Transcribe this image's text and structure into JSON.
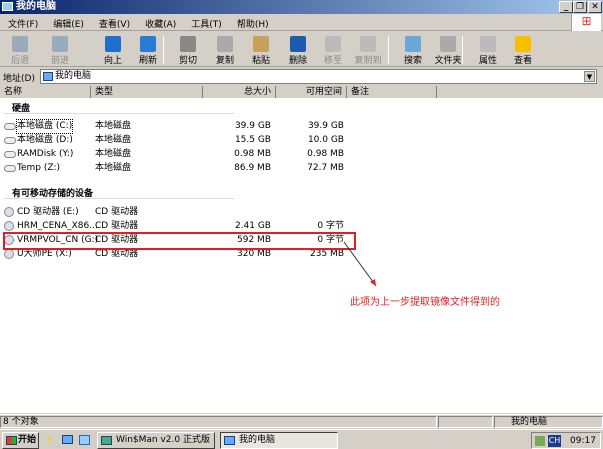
{
  "window": {
    "title": "我的电脑"
  },
  "menu": [
    "文件(F)",
    "编辑(E)",
    "查看(V)",
    "收藏(A)",
    "工具(T)",
    "帮助(H)"
  ],
  "toolbar": [
    {
      "label": "后退",
      "enabled": false,
      "color": "#9ab"
    },
    {
      "label": "前进",
      "enabled": false,
      "color": "#9ab"
    },
    {
      "label": "向上",
      "enabled": true,
      "color": "#1e6fd0"
    },
    {
      "label": "刷新",
      "enabled": true,
      "color": "#2a7bd6"
    },
    {
      "label": "剪切",
      "enabled": true,
      "color": "#888"
    },
    {
      "label": "复制",
      "enabled": true,
      "color": "#aaa"
    },
    {
      "label": "粘贴",
      "enabled": true,
      "color": "#c9a05a"
    },
    {
      "label": "删除",
      "enabled": true,
      "color": "#1c5bb0"
    },
    {
      "label": "移至",
      "enabled": false,
      "color": "#bbb"
    },
    {
      "label": "复制到",
      "enabled": false,
      "color": "#bbb"
    },
    {
      "label": "搜索",
      "enabled": true,
      "color": "#6aa7d8"
    },
    {
      "label": "文件夹",
      "enabled": true,
      "color": "#aaa"
    },
    {
      "label": "属性",
      "enabled": true,
      "color": "#bbb"
    },
    {
      "label": "查看",
      "enabled": true,
      "color": "#f5c000"
    }
  ],
  "address": {
    "label": "地址(D)",
    "value": "我的电脑"
  },
  "columns": [
    "名称",
    "类型",
    "总大小",
    "可用空间",
    "备注"
  ],
  "groups": [
    {
      "title": "硬盘",
      "items": [
        {
          "name": "本地磁盘 (C:)",
          "type": "本地磁盘",
          "size": "39.9 GB",
          "free": "39.9 GB"
        },
        {
          "name": "本地磁盘 (D:)",
          "type": "本地磁盘",
          "size": "15.5 GB",
          "free": "10.0 GB"
        },
        {
          "name": "RAMDisk (Y:)",
          "type": "本地磁盘",
          "size": "0.98 MB",
          "free": "0.98 MB"
        },
        {
          "name": "Temp (Z:)",
          "type": "本地磁盘",
          "size": "86.9 MB",
          "free": "72.7 MB"
        }
      ]
    },
    {
      "title": "有可移动存储的设备",
      "items": [
        {
          "name": "CD 驱动器 (E:)",
          "type": "CD 驱动器",
          "size": "",
          "free": ""
        },
        {
          "name": "HRM_CENA_X86...",
          "type": "CD 驱动器",
          "size": "2.41 GB",
          "free": "0 字节"
        },
        {
          "name": "VRMPVOL_CN (G:)",
          "type": "CD 驱动器",
          "size": "592 MB",
          "free": "0 字节"
        },
        {
          "name": "U大师PE (X:)",
          "type": "CD 驱动器",
          "size": "320 MB",
          "free": "235 MB"
        }
      ]
    }
  ],
  "annotation": "此项为上一步提取镜像文件得到的",
  "status": {
    "count": "8 个对象",
    "location": "我的电脑"
  },
  "taskbar": {
    "start": "开始",
    "tasks": [
      "Win$Man v2.0 正式版",
      "我的电脑"
    ],
    "ime": "CH",
    "clock": "09:17"
  }
}
